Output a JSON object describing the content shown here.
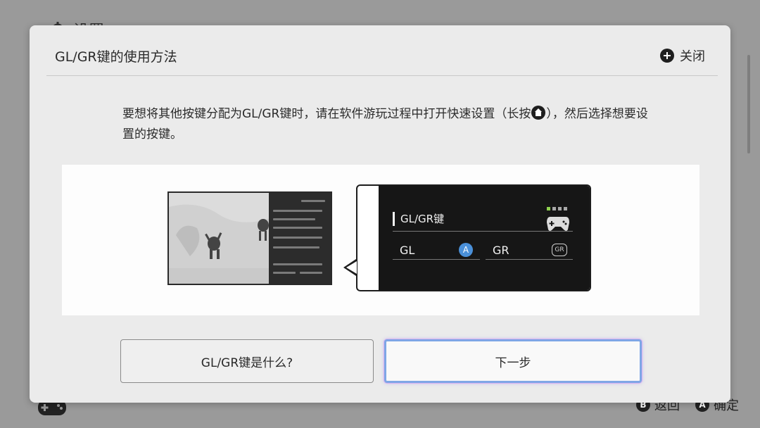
{
  "background": {
    "settings_title": "设置",
    "hints": [
      {
        "key": "B",
        "label": "返回"
      },
      {
        "key": "A",
        "label": "确定"
      }
    ]
  },
  "dialog": {
    "title": "GL/GR键的使用方法",
    "close_label": "关闭",
    "description_part1": "要想将其他按键分配为GL/GR键时，请在软件游玩过程中打开快速设置（长按",
    "description_part2": "），然后选择想要设置的按键。",
    "illustration": {
      "section_title": "GL/GR键",
      "items": [
        {
          "label": "GL",
          "button": "A"
        },
        {
          "label": "GR",
          "button": "GR"
        }
      ]
    },
    "buttons": {
      "what_is_label": "GL/GR键是什么?",
      "next_label": "下一步"
    }
  },
  "colors": {
    "accent_a_button": "#4a90d9",
    "selected_border": "#7fa6e6",
    "active_indicator": "#8fd14f"
  }
}
